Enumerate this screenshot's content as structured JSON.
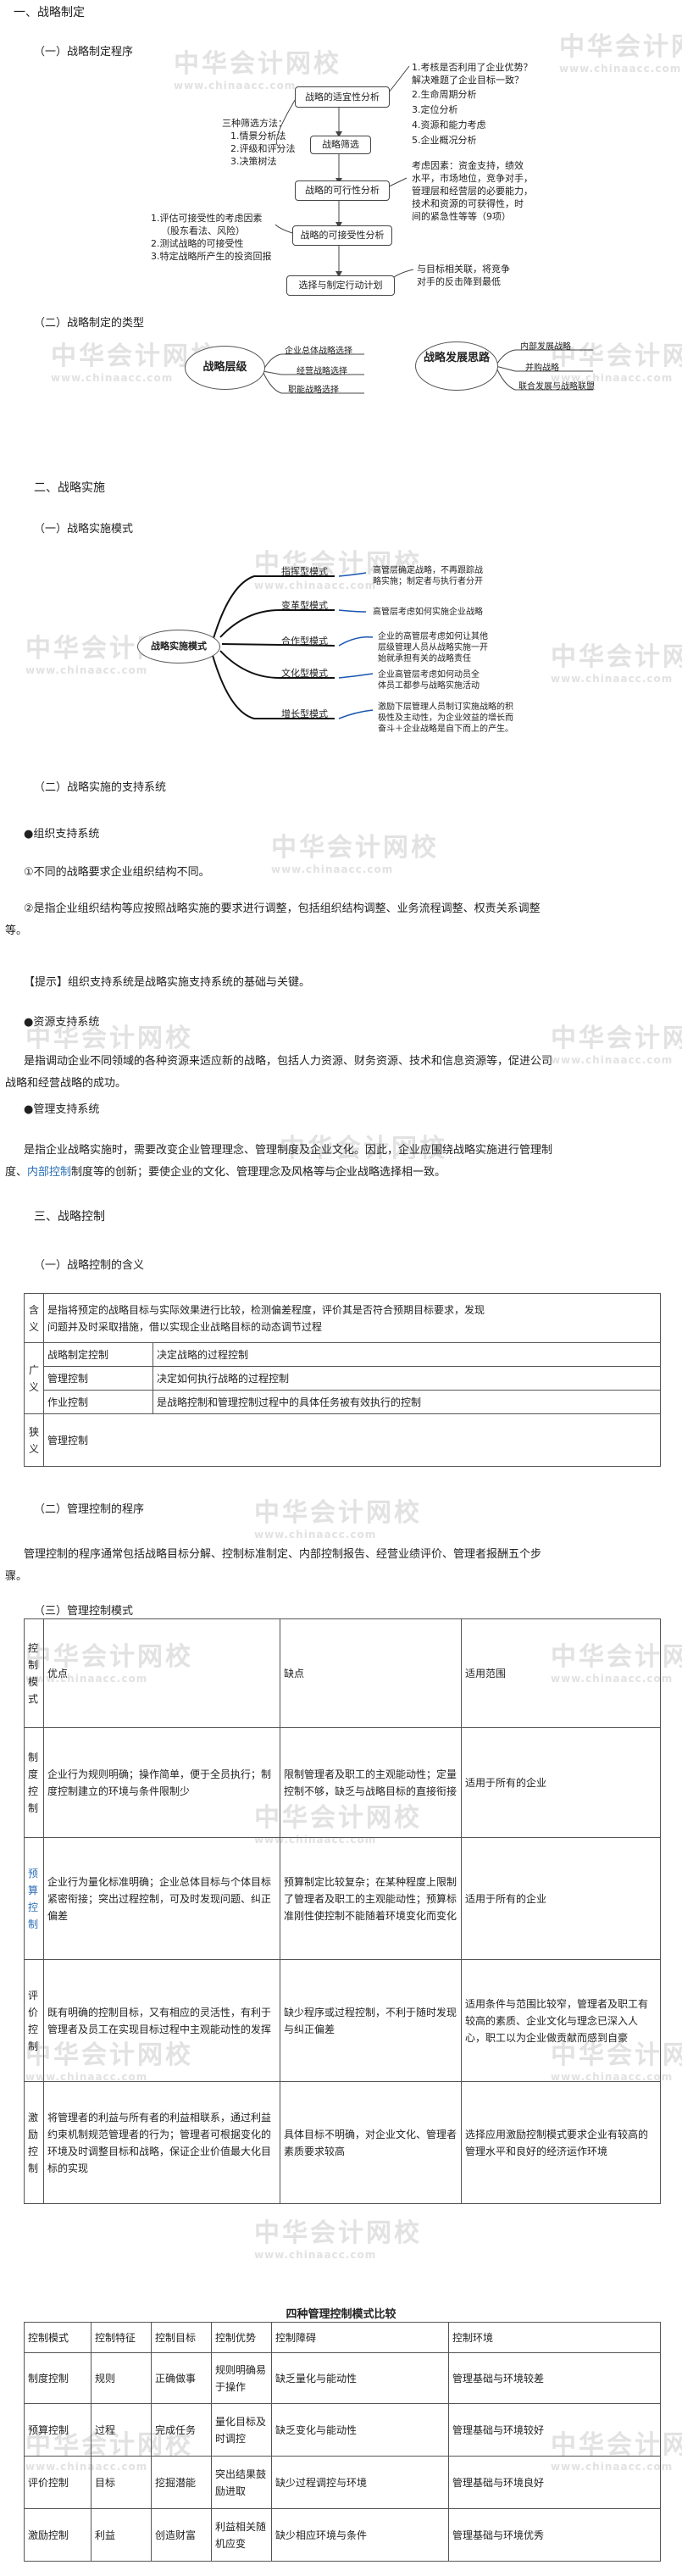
{
  "watermark": {
    "cn": "中华会计网校",
    "en": "www.chinaacc.com"
  },
  "s1": {
    "title": "一、战略制定",
    "sub1": "（一）战略制定程序",
    "flow": [
      "战略的适宜性分析",
      "战略筛选",
      "战略的可行性分析",
      "战略的可接受性分析",
      "选择与制定行动计划"
    ],
    "method_title": "三种筛选方法：",
    "methods": [
      "1.情景分析法",
      "2.评级和评分法",
      "3.决策树法"
    ],
    "right1": [
      "1.考核是否利用了企业优势？",
      "解决难题了企业目标一致？",
      "2.生命周期分析",
      "3.定位分析",
      "4.资源和能力考虑",
      "5.企业概况分析"
    ],
    "right2": [
      "考虑因素：资金支持，绩效",
      "水平，市场地位，竞争对手，",
      "管理层和经营层的必要能力，",
      "技术和资源的可获得性，时",
      "间的紧急性等等（9项）"
    ],
    "left3": [
      "1.评估可接受性的考虑因素",
      "（股东看法、风险）",
      "2.测试战略的可接受性",
      "3.特定战略所产生的投资回报"
    ],
    "right3": [
      "与目标相关联，将竞争",
      "对手的反击降到最低"
    ],
    "sub2": "（二）战略制定的类型",
    "type_left_center": "战略层级",
    "type_left": [
      "企业总体战略选择",
      "经营战略选择",
      "职能战略选择"
    ],
    "type_right_center": "战略发展思路",
    "type_right": [
      "内部发展战略",
      "并购战略",
      "联合发展与战略联盟"
    ]
  },
  "s2": {
    "title": "二、战略实施",
    "sub1": "（一）战略实施模式",
    "center": "战略实施模式",
    "modes": [
      "指挥型模式",
      "变革型模式",
      "合作型模式",
      "文化型模式",
      "增长型模式"
    ],
    "descs": [
      [
        "高管层确定战略，不再跟踪战",
        "略实施；制定者与执行者分开"
      ],
      [
        "高管层考虑如何实施企业战略"
      ],
      [
        "企业的高管层考虑如何让其他",
        "层级管理人员从战略实施一开",
        "始就承担有关的战略责任"
      ],
      [
        "企业高管层考虑如何动员全",
        "体员工都参与战略实施活动"
      ],
      [
        "激励下层管理人员制订实施战略的积",
        "极性及主动性，为企业效益的增长而",
        "奋斗＋企业战略是自下而上的产生。"
      ]
    ],
    "sub2": "（二）战略实施的支持系统",
    "bullet1": "●组织支持系统",
    "p1": "①不同的战略要求企业组织结构不同。",
    "p2a": "②是指企业组织结构等应按照战略实施的要求进行调整，包括组织结构调整、业务流程调整、权责关系调整",
    "p2b": "等。",
    "tip": "【提示】组织支持系统是战略实施支持系统的基础与关键。",
    "bullet2": "●资源支持系统",
    "p3a": "是指调动企业不同领域的各种资源来适应新的战略，包括人力资源、财务资源、技术和信息资源等，促进公司",
    "p3b": "战略和经营战略的成功。",
    "bullet3": "●管理支持系统",
    "p4a": "是指企业战略实施时，需要改变企业管理理念、管理制度及企业文化。因此，企业应围绕战略实施进行管理制",
    "p4b_link": "内部控制",
    "p4b_rest": "制度等的创新；要使企业的文化、管理理念及风格等与企业战略选择相一致。",
    "p4b_pre": "度、"
  },
  "s3": {
    "title": "三、战略控制",
    "sub1": "（一）战略控制的含义",
    "def_label": "含义",
    "def_text_a": "是指将预定的战略目标与实际效果进行比较，检测偏差程度，评价其是否符合预期目标要求，发现",
    "def_text_b": "问题并及时采取措施，借以实现企业战略目标的动态调节过程",
    "broad_label": "广义",
    "broad": [
      {
        "k": "战略制定控制",
        "v": "决定战略的过程控制"
      },
      {
        "k": "管理控制",
        "v": "决定如何执行战略的过程控制"
      },
      {
        "k": "作业控制",
        "v": "是战略控制和管理控制过程中的具体任务被有效执行的控制"
      }
    ],
    "narrow_label": "狭义",
    "narrow_v": "管理控制",
    "sub2": "（二）管理控制的程序",
    "proc_a": "管理控制的程序通常包括战略目标分解、控制标准制定、内部控制报告、经营业绩评价、管理者报酬五个步",
    "proc_b": "骤。",
    "sub3": "（三）管理控制模式",
    "t1_head": [
      "控制模式",
      "优点",
      "缺点",
      "适用范围"
    ],
    "t1_rows": [
      {
        "mode": "制度控制",
        "pros": "企业行为规则明确；操作简单，便于全员执行；制度控制建立的环境与条件限制少",
        "cons": "限制管理者及职工的主观能动性；定量控制不够，缺乏与战略目标的直接衔接",
        "scope": "适用于所有的企业"
      },
      {
        "mode": "预算控制",
        "pros": "企业行为量化标准明确；企业总体目标与个体目标紧密衔接；突出过程控制，可及时发现问题、纠正偏差",
        "cons": "预算制定比较复杂；在某种程度上限制了管理者及职工的主观能动性；预算标准刚性使控制不能随着环境变化而变化",
        "scope": "适用于所有的企业"
      },
      {
        "mode": "评价控制",
        "pros": "既有明确的控制目标，又有相应的灵活性，有利于管理者及员工在实现目标过程中主观能动性的发挥",
        "cons": "缺少程序或过程控制，不利于随时发现与纠正偏差",
        "scope": "适用条件与范围比较窄，管理者及职工有较高的素质、企业文化与理念已深入人心，职工以为企业做贡献而感到自豪"
      },
      {
        "mode": "激励控制",
        "pros": "将管理者的利益与所有者的利益相联系，通过利益约束机制规范管理者的行为；管理者可根据变化的环境及时调整目标和战略，保证企业价值最大化目标的实现",
        "cons": "具体目标不明确，对企业文化、管理者素质要求较高",
        "scope": "选择应用激励控制模式要求企业有较高的管理水平和良好的经济运作环境"
      }
    ],
    "t2_title": "四种管理控制模式比较",
    "t2_head": [
      "控制模式",
      "控制特征",
      "控制目标",
      "控制优势",
      "控制障碍",
      "控制环境"
    ],
    "t2_rows": [
      [
        "制度控制",
        "规则",
        "正确做事",
        "规则明确易于操作",
        "缺乏量化与能动性",
        "管理基础与环境较差"
      ],
      [
        "预算控制",
        "过程",
        "完成任务",
        "量化目标及时调控",
        "缺乏变化与能动性",
        "管理基础与环境较好"
      ],
      [
        "评价控制",
        "目标",
        "挖掘潜能",
        "突出结果鼓励进取",
        "缺少过程调控与环境",
        "管理基础与环境良好"
      ],
      [
        "激励控制",
        "利益",
        "创造财富",
        "利益相关随机应变",
        "缺少相应环境与条件",
        "管理基础与环境优秀"
      ]
    ]
  }
}
